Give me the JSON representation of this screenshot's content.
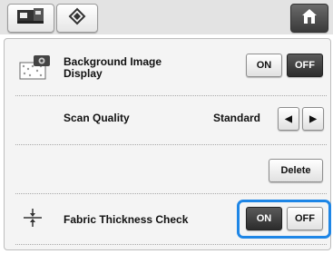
{
  "toolbar": {
    "embroidery_icon": "embroidery-machine-icon",
    "settings_icon": "diamond-settings-icon",
    "home_icon": "home-icon"
  },
  "background_image": {
    "label_line1": "Background Image",
    "label_line2": "Display",
    "on_label": "ON",
    "off_label": "OFF",
    "selected": "OFF"
  },
  "scan_quality": {
    "label": "Scan Quality",
    "value": "Standard",
    "left_arrow": "◀",
    "right_arrow": "▶"
  },
  "delete_label": "Delete",
  "fabric_thickness": {
    "label": "Fabric Thickness Check",
    "on_label": "ON",
    "off_label": "OFF",
    "selected": "ON"
  },
  "colors": {
    "highlight": "#1e86e6",
    "selected_button": "#3a3a3a"
  }
}
